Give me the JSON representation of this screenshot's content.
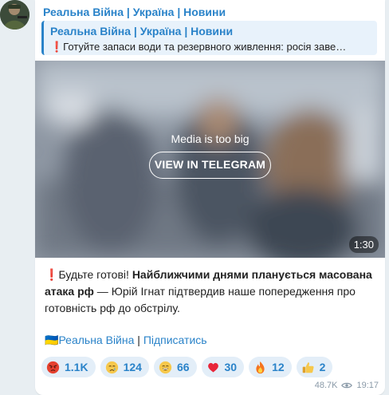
{
  "channel": {
    "name": "Реальна Війна | Україна | Новини",
    "accent": "#2a83c9"
  },
  "reply": {
    "title": "Реальна Війна | Україна | Новини",
    "text": "❗️Готуйте запаси води та резервного живлення: росія заве…"
  },
  "media": {
    "message": "Media is too big",
    "button_label": "VIEW IN TELEGRAM",
    "duration": "1:30"
  },
  "post": {
    "mark": "❗️",
    "lead": "Будьте готові! ",
    "bold": "Найближчими днями планується масована атака рф",
    "rest": " — Юрій Ігнат підтвердив наше попередження про готовність рф до обстрілу.",
    "flag": "🇺🇦",
    "footer_link": "Реальна Війна",
    "footer_sep": " | ",
    "footer_subscribe": "Підписатись"
  },
  "reactions": [
    {
      "emoji": "angry",
      "count": "1.1K"
    },
    {
      "emoji": "crying",
      "count": "124"
    },
    {
      "emoji": "grin",
      "count": "66"
    },
    {
      "emoji": "heart",
      "count": "30"
    },
    {
      "emoji": "fire",
      "count": "12"
    },
    {
      "emoji": "thumbs-up",
      "count": "2"
    }
  ],
  "meta": {
    "views": "48.7K",
    "time": "19:17"
  }
}
